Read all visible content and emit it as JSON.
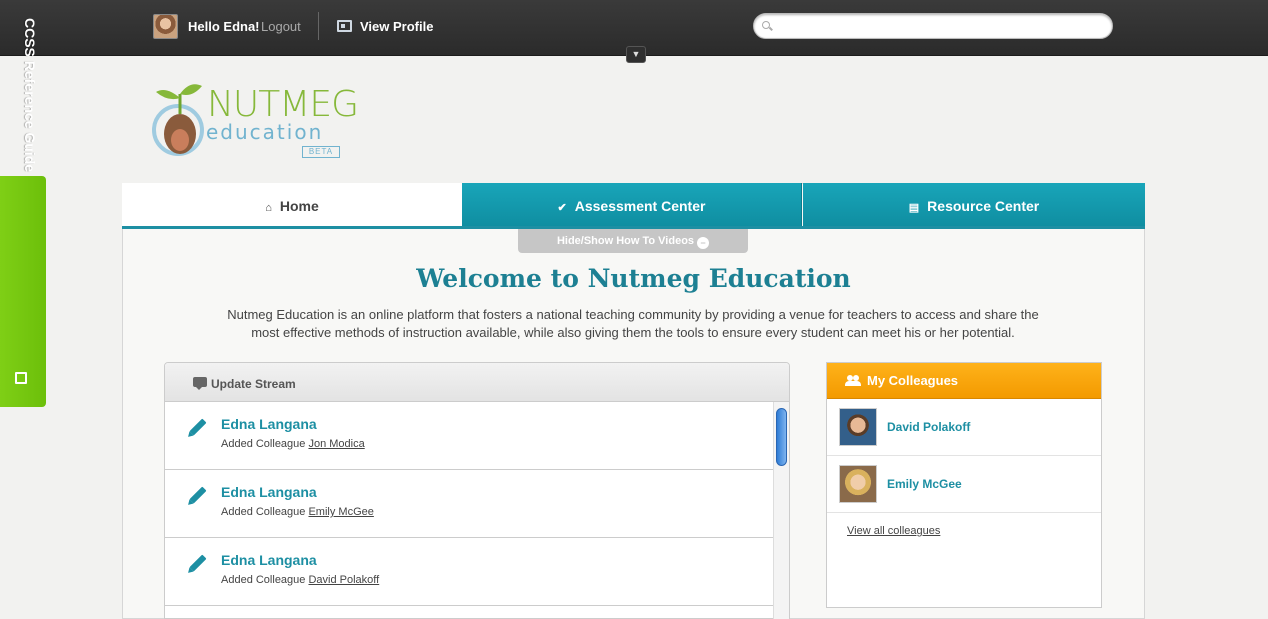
{
  "topbar": {
    "greeting": "Hello Edna!",
    "logout": "Logout",
    "view_profile": "View Profile",
    "search_placeholder": ""
  },
  "logo": {
    "name": "NUTMEG",
    "sub": "education",
    "badge": "BETA"
  },
  "side_tab": {
    "label": "CCSS Reference Guide"
  },
  "tabs": [
    {
      "label": "Home",
      "icon": "home-icon"
    },
    {
      "label": "Assessment Center",
      "icon": "checkmark-icon"
    },
    {
      "label": "Resource Center",
      "icon": "book-icon"
    }
  ],
  "hide_show": "Hide/Show How To Videos",
  "welcome": {
    "title": "Welcome to Nutmeg Education",
    "intro": "Nutmeg Education is an online platform that fosters a national teaching community by providing a venue for teachers to access and share the most effective methods of instruction available, while also giving them the tools to ensure every student can meet his or her potential."
  },
  "stream": {
    "title": "Update Stream",
    "items": [
      {
        "name": "Edna Langana",
        "action": "Added Colleague",
        "target": "Jon Modica"
      },
      {
        "name": "Edna Langana",
        "action": "Added Colleague",
        "target": "Emily McGee"
      },
      {
        "name": "Edna Langana",
        "action": "Added Colleague",
        "target": "David Polakoff"
      }
    ]
  },
  "colleagues": {
    "title": "My Colleagues",
    "items": [
      {
        "name": "David Polakoff"
      },
      {
        "name": "Emily McGee"
      }
    ],
    "view_all": "View all colleagues"
  },
  "colors": {
    "accent": "#1d8fa3",
    "green": "#7fcf16",
    "orange": "#f39a00"
  }
}
